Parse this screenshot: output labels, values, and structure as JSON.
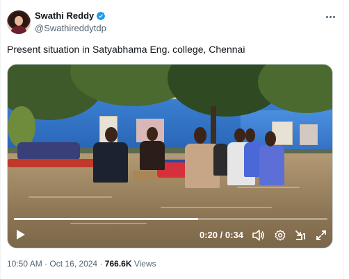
{
  "author": {
    "name": "Swathi Reddy",
    "handle": "@Swathireddytdp",
    "verified": true
  },
  "tweet": {
    "text": "Present situation in Satyabhama Eng. college, Chennai"
  },
  "video": {
    "current_time": "0:20",
    "separator": "/",
    "duration": "0:34",
    "progress": 0.588
  },
  "meta": {
    "time": "10:50 AM",
    "dot1": "·",
    "date": "Oct 16, 2024",
    "dot2": "·",
    "views_count": "766.6K",
    "views_label": "Views"
  },
  "colors": {
    "verified": "#1d9bf0",
    "secondary_text": "#536471",
    "primary_text": "#0f1419"
  },
  "icons": [
    "verified-badge-icon",
    "more-options-icon",
    "play-icon",
    "volume-icon",
    "settings-icon",
    "minimize-icon",
    "fullscreen-icon"
  ]
}
